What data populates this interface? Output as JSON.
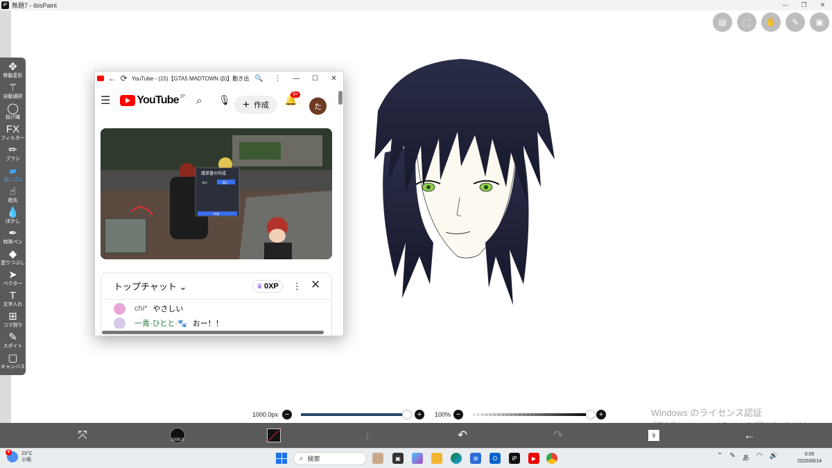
{
  "window": {
    "title": "無題7 - ibisPaint",
    "app_icon": "iP",
    "controls": [
      "—",
      "❐",
      "✕"
    ]
  },
  "top_right_buttons": [
    {
      "icon": "layers-icon",
      "glyph": "▤"
    },
    {
      "icon": "selection-icon",
      "glyph": "⬚"
    },
    {
      "icon": "hand-icon",
      "glyph": "✋"
    },
    {
      "icon": "ruler-icon",
      "glyph": "✎"
    },
    {
      "icon": "gallery-icon",
      "glyph": "▣"
    }
  ],
  "toolbar": {
    "items": [
      {
        "id": "transform",
        "glyph": "✥",
        "label": "移動変形"
      },
      {
        "id": "magic-wand",
        "glyph": "⚚",
        "label": "自動選択"
      },
      {
        "id": "lasso",
        "glyph": "◯",
        "label": "投げ縄"
      },
      {
        "id": "filter",
        "glyph": "FX",
        "label": "フィルター"
      },
      {
        "id": "brush",
        "glyph": "✏",
        "label": "ブラシ"
      },
      {
        "id": "eraser",
        "glyph": "▰",
        "label": "消しゴム",
        "active": true
      },
      {
        "id": "smudge",
        "glyph": "☝",
        "label": "指先"
      },
      {
        "id": "blur",
        "glyph": "💧",
        "label": "ぼかし"
      },
      {
        "id": "special-pen",
        "glyph": "✒",
        "label": "特殊ペン"
      },
      {
        "id": "fill",
        "glyph": "◆",
        "label": "塗りつぶし"
      },
      {
        "id": "vector",
        "glyph": "➤",
        "label": "ベクター"
      },
      {
        "id": "text",
        "glyph": "T",
        "label": "文字入れ"
      },
      {
        "id": "frame",
        "glyph": "⊞",
        "label": "コマ割り"
      },
      {
        "id": "eyedropper",
        "glyph": "✎",
        "label": "スポイト"
      },
      {
        "id": "canvas",
        "glyph": "▢",
        "label": "キャンバス"
      }
    ]
  },
  "youtube_window": {
    "title": "YouTube - (15)【GTA5 MADTOWN (β)】動き出...",
    "back": "←",
    "reload": "⟳",
    "zoom_glyph": "🔍",
    "menu_glyph": "⋮",
    "controls": [
      "—",
      "☐",
      "✕"
    ],
    "logo_text": "YouTube",
    "region": "JP",
    "create_label": "作成",
    "notification_badge": "9+",
    "avatar_letter": "た",
    "video": {
      "popup_title": "請求書の作成",
      "tag_left": "請求",
      "tag_right": "個人",
      "submit": "作成"
    },
    "chat": {
      "title": "トップチャット",
      "xp": "0XP",
      "messages": [
        {
          "name": "chi*",
          "text": "やさしい",
          "avatar_color": "#e8a7d8"
        },
        {
          "name": "一青·ひとと·🐾",
          "text": "おー！！",
          "avatar_color": "#d8c8e8"
        }
      ]
    }
  },
  "sliders": {
    "brush_size": "1000.0px",
    "brush_size_fraction": 0.98,
    "opacity": "100%",
    "opacity_fraction": 1.0
  },
  "watermark": {
    "line1": "Windows のライセンス認証",
    "line2": "設定を開き、Windows のライセンス認証を行ってください。"
  },
  "bottom_bar": {
    "brush_size_indicator": "1000.0",
    "layer_count": "9"
  },
  "taskbar": {
    "weather_temp": "23°C",
    "weather_desc": "小雨",
    "weather_badge": "8",
    "search_placeholder": "検索",
    "clock_time": "0:05",
    "clock_date": "2025/06/14",
    "ime": "あ"
  },
  "colors": {
    "toolbar_bg": "#5a5a5a",
    "active_tool": "#3ea5ff",
    "youtube_red": "#ff0000",
    "hair": "#1e2238",
    "eye": "#8fd14f"
  }
}
